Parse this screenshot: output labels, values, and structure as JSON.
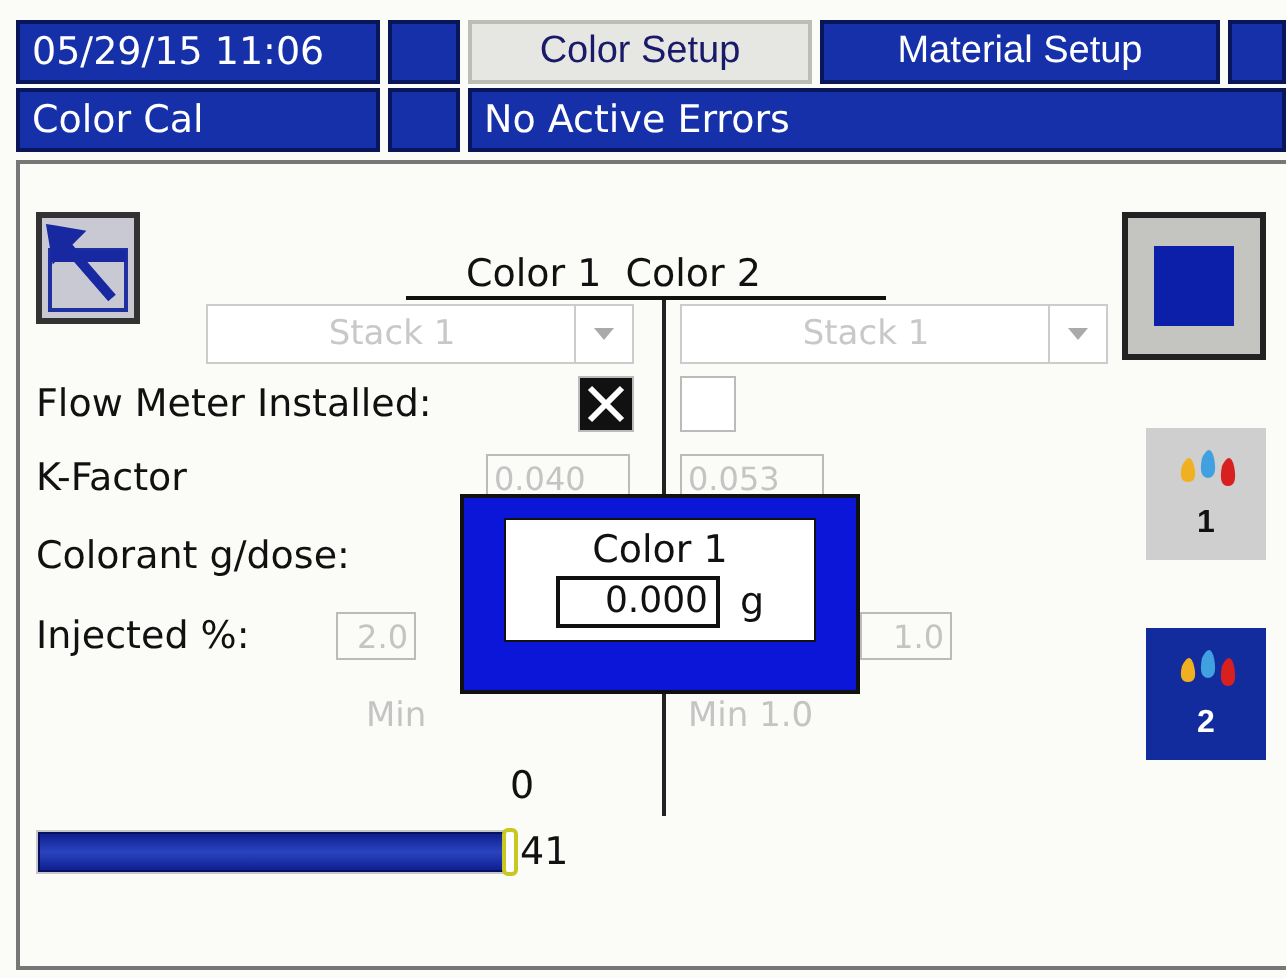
{
  "header": {
    "clock": "05/29/15 11:06",
    "tabs": [
      {
        "label": "Color Setup",
        "selected": true
      },
      {
        "label": "Material Setup",
        "selected": false
      }
    ],
    "screen": "Color Cal",
    "status": "No Active Errors"
  },
  "columns": [
    "Color 1",
    "Color 2"
  ],
  "dropdowns": [
    {
      "value": "Stack 1",
      "disabled": true
    },
    {
      "value": "Stack 1",
      "disabled": true
    }
  ],
  "flow_meter": {
    "label": "Flow Meter Installed:",
    "values": [
      {
        "checked": true
      },
      {
        "checked": false
      }
    ]
  },
  "k_factor": {
    "label": "K-Factor",
    "values": [
      "0.040",
      "0.053"
    ]
  },
  "colorant": {
    "label": "Colorant g/dose:"
  },
  "injected": {
    "label": "Injected %:",
    "values": [
      "2.0",
      "1.0"
    ]
  },
  "minimums": [
    "Min",
    "Min 1.0"
  ],
  "zero": "0",
  "slider": {
    "level": 1,
    "reading": "41"
  },
  "side_buttons": [
    {
      "kind": "stop"
    },
    {
      "kind": "color",
      "number": "1",
      "selected": false
    },
    {
      "kind": "color",
      "number": "2",
      "selected": true
    }
  ],
  "dialog": {
    "title": "Color 1",
    "value": "0.000",
    "unit": "g"
  }
}
